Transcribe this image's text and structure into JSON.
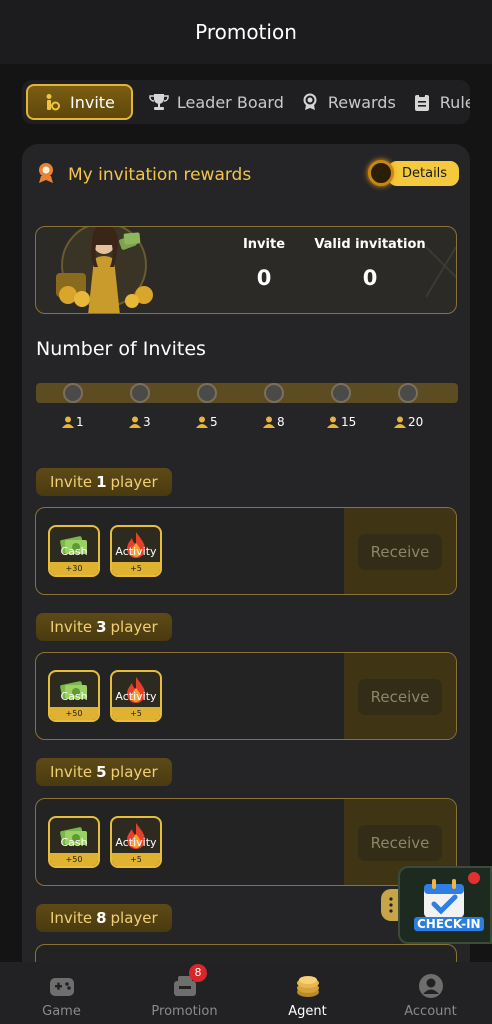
{
  "header": {
    "title": "Promotion"
  },
  "tabs": [
    {
      "label": "Invite",
      "icon": "invite-icon",
      "active": true
    },
    {
      "label": "Leader Board",
      "icon": "trophy-icon"
    },
    {
      "label": "Rewards",
      "icon": "medal-icon"
    },
    {
      "label": "Rule",
      "icon": "clipboard-icon"
    }
  ],
  "rewards": {
    "title": "My invitation rewards",
    "details_label": "Details",
    "invite_label": "Invite",
    "invite_value": "0",
    "valid_label": "Valid invitation",
    "valid_value": "0"
  },
  "invites_section": {
    "title": "Number of Invites",
    "milestones": [
      "1",
      "3",
      "5",
      "8",
      "15",
      "20"
    ]
  },
  "tiers": [
    {
      "prefix": "Invite",
      "count": "1",
      "suffix": "player",
      "cash_label": "Cash",
      "cash_amount": "+30",
      "activity_label": "Activity",
      "activity_amount": "+5",
      "button": "Receive"
    },
    {
      "prefix": "Invite",
      "count": "3",
      "suffix": "player",
      "cash_label": "Cash",
      "cash_amount": "+50",
      "activity_label": "Activity",
      "activity_amount": "+5",
      "button": "Receive"
    },
    {
      "prefix": "Invite",
      "count": "5",
      "suffix": "player",
      "cash_label": "Cash",
      "cash_amount": "+50",
      "activity_label": "Activity",
      "activity_amount": "+5",
      "button": "Receive"
    },
    {
      "prefix": "Invite",
      "count": "8",
      "suffix": "player"
    }
  ],
  "checkin": {
    "label": "CHECK-IN"
  },
  "bottom_nav": [
    {
      "label": "Game",
      "icon": "gamepad-icon"
    },
    {
      "label": "Promotion",
      "icon": "promotion-icon",
      "badge": "8"
    },
    {
      "label": "Agent",
      "icon": "coins-icon",
      "active": true
    },
    {
      "label": "Account",
      "icon": "account-icon"
    }
  ],
  "colors": {
    "accent": "#f5c93e",
    "background": "#141414",
    "card": "#252527",
    "badge": "#d8262a"
  }
}
